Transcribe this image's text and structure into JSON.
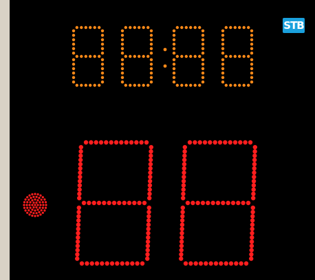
{
  "scoreboard": {
    "brand": "STB",
    "timer_display": "88:88",
    "score_display": "88",
    "colors": {
      "background": "#000000",
      "timer_led": "#ff8a18",
      "score_led": "#ff1e1e",
      "possession_led": "#ff1e1e",
      "logo_bg": "#1aa0dd",
      "frame": "#d9d2c6"
    },
    "icons": [
      "possession-indicator-icon",
      "brand-logo-icon"
    ]
  }
}
